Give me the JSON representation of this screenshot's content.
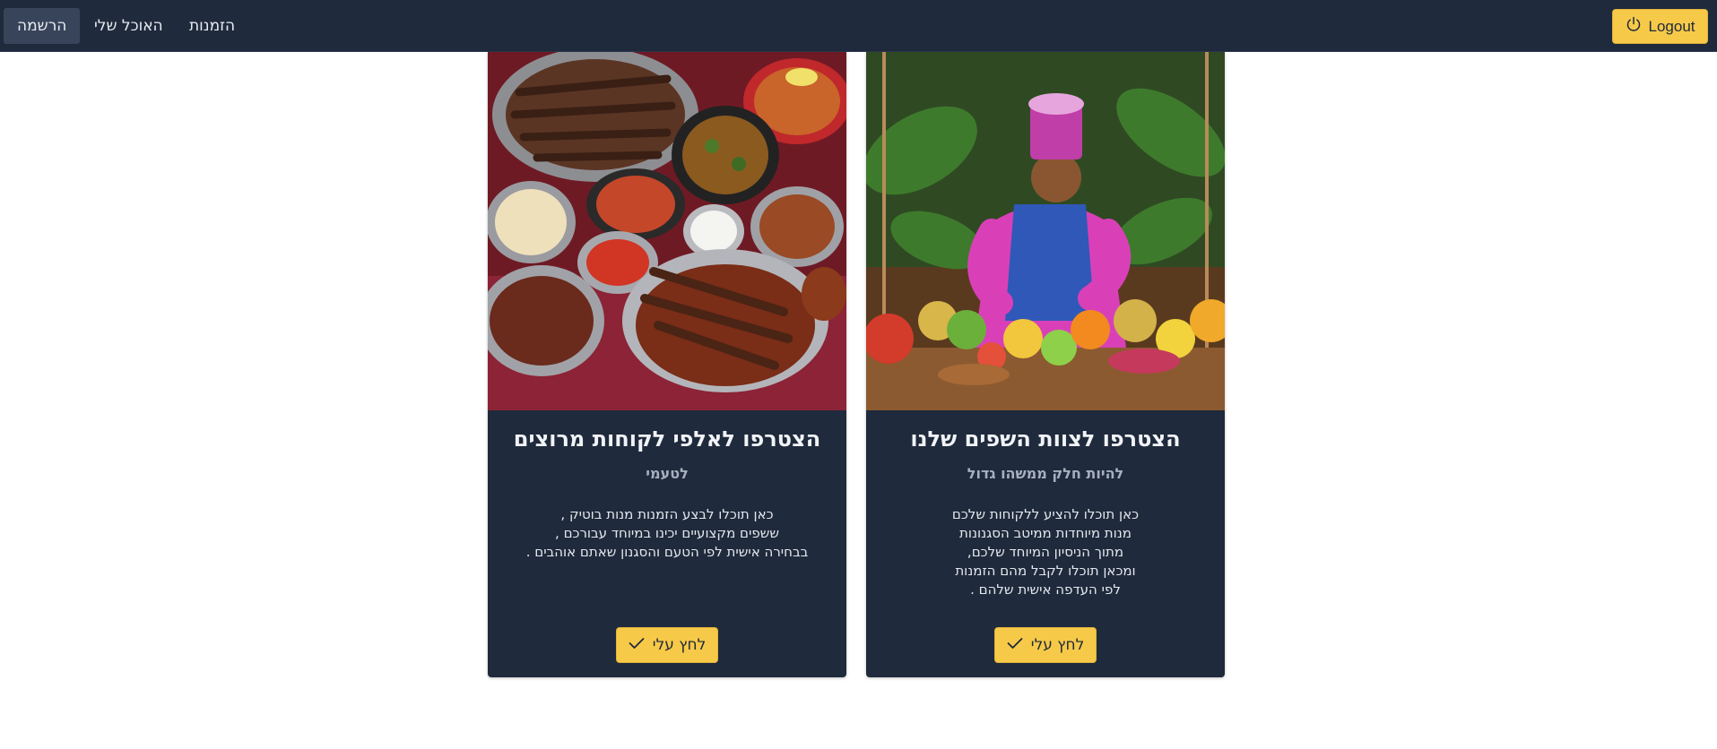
{
  "nav": {
    "items": [
      {
        "label": "הרשמה",
        "active": true
      },
      {
        "label": "האוכל שלי",
        "active": false
      },
      {
        "label": "הזמנות",
        "active": false
      }
    ],
    "logout_label": "Logout"
  },
  "cards": [
    {
      "title": "הצטרפו לאלפי לקוחות מרוצים",
      "subtitle": "לטעמי",
      "body": [
        "כאן תוכלו לבצע הזמנות מנות בוטיק ,",
        "ששפים מקצועיים יכינו במיוחד עבורכם ,",
        "בבחירה אישית לפי הטעם והסגנון שאתם אוהבים ."
      ],
      "button_label": "לחץ עלי",
      "image": "food-platter-image"
    },
    {
      "title": "הצטרפו לצוות השפים שלנו",
      "subtitle": "להיות חלק ממשהו גדול",
      "body": [
        "כאן תוכלו להציע ללקוחות שלכם",
        "מנות מיוחדות ממיטב הסגנונות",
        "מתוך הניסיון המיוחד שלכם,",
        "ומכאן תוכלו לקבל מהם הזמנות",
        "לפי העדפה אישית שלהם ."
      ],
      "button_label": "לחץ עלי",
      "image": "chef-fruit-image"
    }
  ],
  "colors": {
    "navbar": "#1f2a3c",
    "card": "#1f2a3c",
    "accent": "#f7c948"
  }
}
